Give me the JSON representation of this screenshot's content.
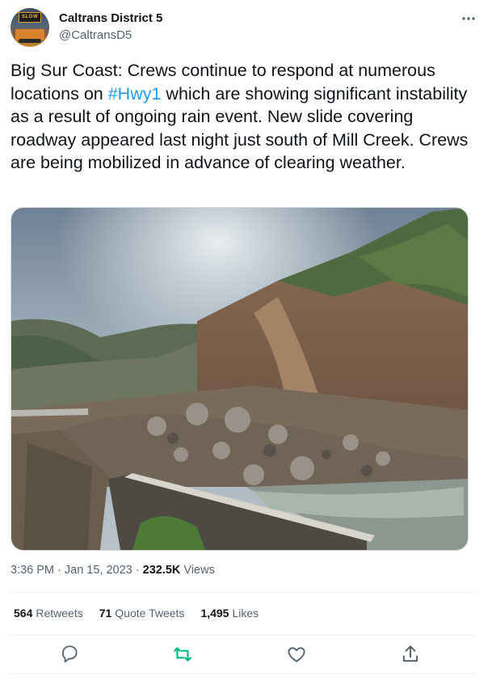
{
  "account": {
    "name": "Caltrans District 5",
    "handle": "@CaltransD5",
    "avatar_sign_text": "SLOW"
  },
  "tweet": {
    "text_before": "Big Sur Coast: Crews continue to respond at numerous locations on ",
    "hashtag": "#Hwy1",
    "text_after": " which are showing significant instability as a result of ongoing rain event. New slide covering roadway appeared last night just south of Mill Creek. Crews are being mobilized in advance of clearing weather."
  },
  "meta": {
    "time_date": "3:36 PM · Jan 15, 2023 · ",
    "views_count": "232.5K",
    "views_label": " Views"
  },
  "stats": {
    "retweets_count": "564",
    "retweets_label": "Retweets",
    "quote_count": "71",
    "quote_label": "Quote Tweets",
    "likes_count": "1,495",
    "likes_label": "Likes"
  },
  "colors": {
    "link": "#1d9bf0",
    "secondary_text": "#536471",
    "retweet_green": "#00ba7c"
  },
  "icons": {
    "more": "more-icon",
    "reply": "reply-icon",
    "retweet": "retweet-icon",
    "like": "heart-icon",
    "share": "share-icon"
  }
}
